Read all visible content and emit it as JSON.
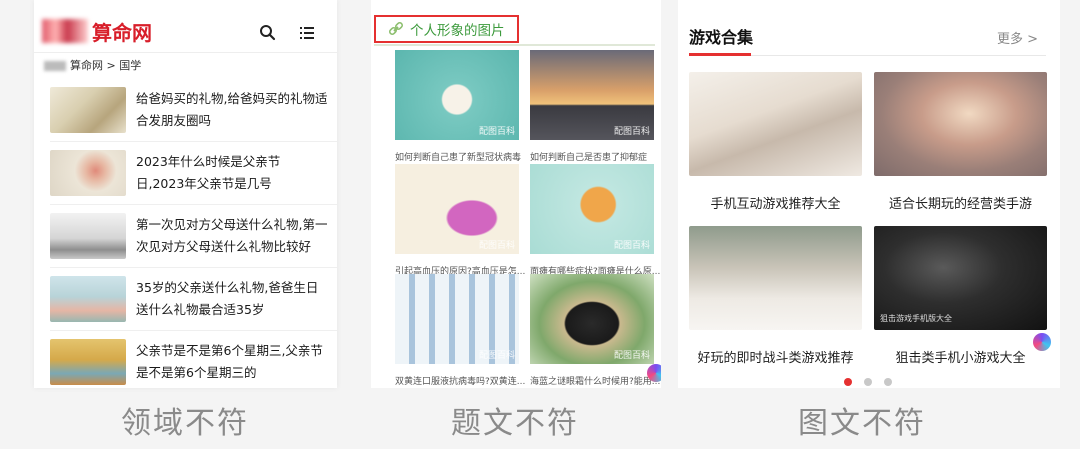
{
  "panel1": {
    "logo_text": "算命网",
    "breadcrumb": "算命网 > 国学",
    "articles": [
      {
        "title": "给爸妈买的礼物,给爸妈买的礼物适合发朋友圈吗"
      },
      {
        "title": "2023年什么时候是父亲节日,2023年父亲节是几号"
      },
      {
        "title": "第一次见对方父母送什么礼物,第一次见对方父母送什么礼物比较好"
      },
      {
        "title": "35岁的父亲送什么礼物,爸爸生日送什么礼物最合适35岁"
      },
      {
        "title": "父亲节是不是第6个星期三,父亲节是不是第6个星期三的"
      }
    ],
    "caption": "领域不符"
  },
  "panel2": {
    "heading": "个人形象的图片",
    "watermark": "配图百科",
    "cards": [
      {
        "caption": "如何判断自己患了新型冠状病毒"
      },
      {
        "caption": "如何判断自己是否患了抑郁症"
      },
      {
        "caption": "引起高血压的原因?高血压是怎..."
      },
      {
        "caption": "面瘫有哪些症状?面瘫是什么原..."
      },
      {
        "caption": "双黄连口服液抗病毒吗?双黄连..."
      },
      {
        "caption": "海蓝之谜眼霜什么时候用?能用..."
      }
    ],
    "caption": "题文不符"
  },
  "panel3": {
    "heading": "游戏合集",
    "more": "更多 >",
    "games": [
      {
        "label": "手机互动游戏推荐大全"
      },
      {
        "label": "适合长期玩的经营类手游"
      },
      {
        "label": "好玩的即时战斗类游戏推荐"
      },
      {
        "label": "狙击类手机小游戏大全",
        "overlay": "狙击游戏手机版大全"
      }
    ],
    "caption": "图文不符"
  },
  "colors": {
    "accent_red": "#e53030",
    "link_green": "#3c9a3c",
    "caption_gray": "#8a8a8a"
  }
}
